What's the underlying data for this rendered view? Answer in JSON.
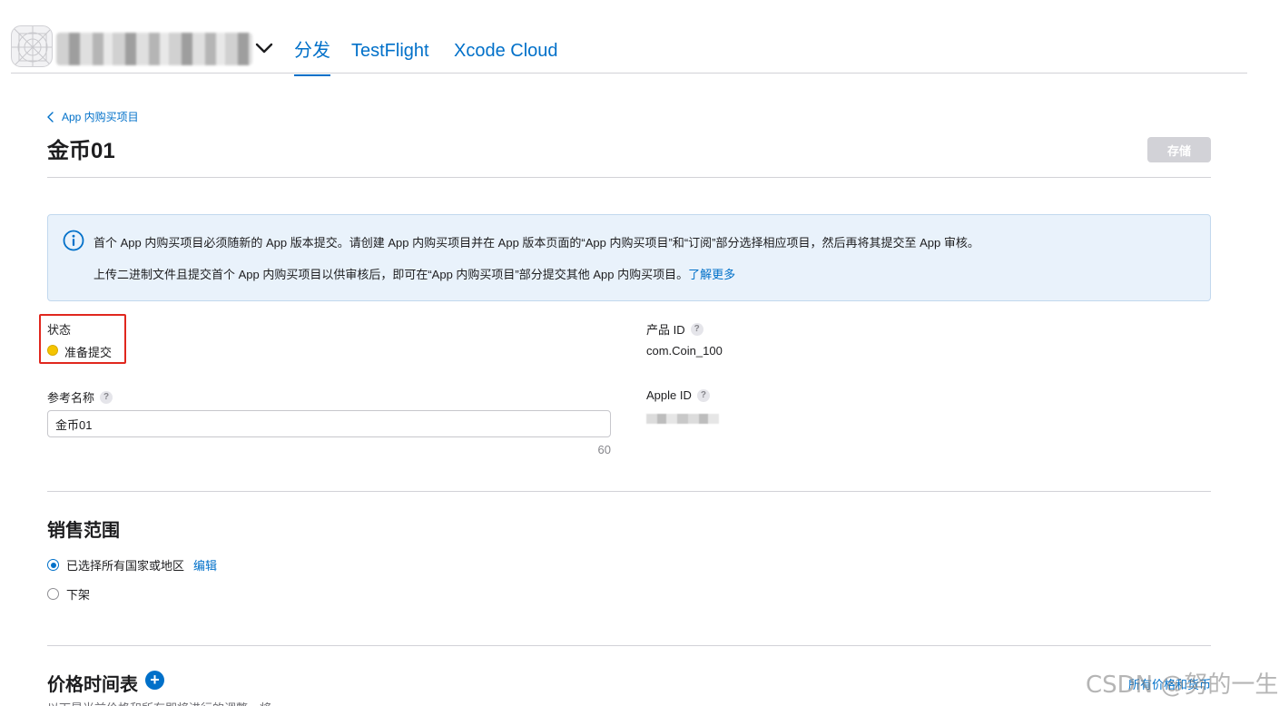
{
  "nav": {
    "tabs": [
      {
        "label": "分发",
        "active": true
      },
      {
        "label": "TestFlight",
        "active": false
      },
      {
        "label": "Xcode Cloud",
        "active": false
      }
    ]
  },
  "breadcrumb": {
    "label": "App 内购买项目"
  },
  "page": {
    "title": "金币01",
    "save_label": "存储"
  },
  "info": {
    "line1": "首个 App 内购买项目必须随新的 App 版本提交。请创建 App 内购买项目并在 App 版本页面的“App 内购买项目”和“订阅”部分选择相应项目，然后再将其提交至 App 审核。",
    "line2": "上传二进制文件且提交首个 App 内购买项目以供审核后，即可在“App 内购买项目”部分提交其他 App 内购买项目。",
    "link": "了解更多"
  },
  "fields": {
    "status_label": "状态",
    "status_value": "准备提交",
    "status_color": "#f5c400",
    "product_id_label": "产品 ID",
    "product_id_value": "com.Coin_100",
    "reference_name_label": "参考名称",
    "reference_name_value": "金币01",
    "reference_name_max": "60",
    "apple_id_label": "Apple ID",
    "help_glyph": "?"
  },
  "availability": {
    "title": "销售范围",
    "options": [
      {
        "label": "已选择所有国家或地区",
        "checked": true,
        "action": "编辑"
      },
      {
        "label": "下架",
        "checked": false
      }
    ]
  },
  "pricing": {
    "title": "价格时间表",
    "add_glyph": "+",
    "all_prices_link": "所有价格和货币",
    "description_partial": "以下是当前价格和所有即将进行的调整，将"
  },
  "watermark": "CSDN @努的一生",
  "colors": {
    "accent": "#0070c9",
    "highlight_border": "#e0271e"
  }
}
